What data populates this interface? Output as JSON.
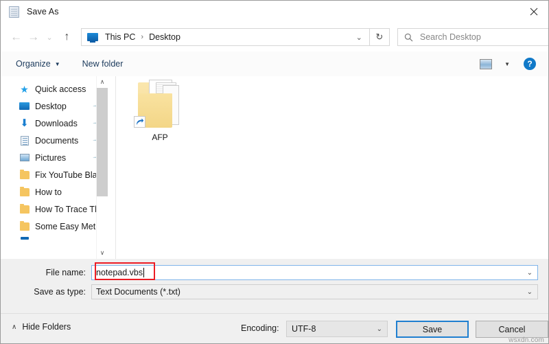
{
  "window": {
    "title": "Save As",
    "app_icon": "notepad-icon",
    "close_label": "✕"
  },
  "nav": {
    "back": "←",
    "forward": "→",
    "recent": "⌄",
    "up": "↑",
    "refresh": "↻",
    "address": {
      "computer_icon": "this-pc-icon",
      "crumbs": [
        "This PC",
        "Desktop"
      ],
      "separator": "›",
      "dropdown": "⌄"
    },
    "search": {
      "placeholder": "Search Desktop",
      "icon": "search-icon"
    }
  },
  "toolbar": {
    "organize": "Organize",
    "organize_caret": "▼",
    "new_folder": "New folder",
    "view_caret": "▼",
    "help": "?"
  },
  "sidebar": {
    "items": [
      {
        "label": "Quick access",
        "icon": "star-icon",
        "pinned": false
      },
      {
        "label": "Desktop",
        "icon": "monitor-icon",
        "pinned": true
      },
      {
        "label": "Downloads",
        "icon": "download-icon",
        "pinned": true
      },
      {
        "label": "Documents",
        "icon": "document-icon",
        "pinned": true
      },
      {
        "label": "Pictures",
        "icon": "picture-icon",
        "pinned": true
      },
      {
        "label": "Fix YouTube Blac",
        "icon": "folder-icon",
        "pinned": false
      },
      {
        "label": "How to",
        "icon": "folder-icon",
        "pinned": false
      },
      {
        "label": "How To Trace Th",
        "icon": "folder-icon",
        "pinned": false
      },
      {
        "label": "Some Easy Meth",
        "icon": "folder-icon",
        "pinned": false
      }
    ],
    "scroll_up": "∧",
    "scroll_down": "∨"
  },
  "files": [
    {
      "name": "AFP",
      "type": "folder-shortcut",
      "shortcut_arrow": "↗"
    }
  ],
  "form": {
    "file_name_label": "File name:",
    "file_name_value": "notepad.vbs",
    "save_as_type_label": "Save as type:",
    "save_as_type_value": "Text Documents (*.txt)",
    "dropdown_caret": "⌄",
    "highlight_color": "#ec1c24"
  },
  "footer": {
    "hide_folders": "Hide Folders",
    "hide_folders_chevron": "∧",
    "encoding_label": "Encoding:",
    "encoding_value": "UTF-8",
    "encoding_caret": "⌄",
    "save_button": "Save",
    "cancel_button": "Cancel",
    "watermark": "wsxdn.com"
  }
}
